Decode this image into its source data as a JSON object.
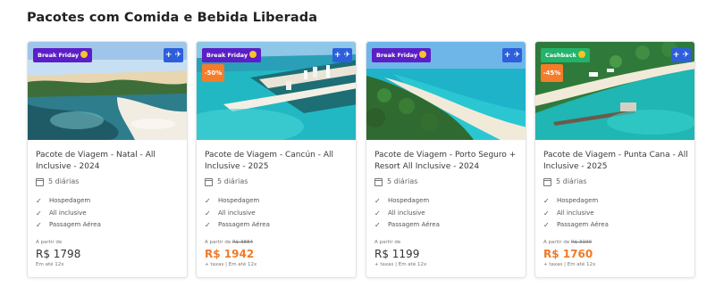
{
  "section_title": "Pacotes com Comida e Bebida Liberada",
  "cards": [
    {
      "badge": "Break Friday",
      "badge_color": "#5b1fc7",
      "type_icon": "flight-package-icon",
      "type_label": "+ ✈",
      "discount": "",
      "title": "Pacote de Viagem - Natal - All Inclusive - 2024",
      "duration": "5 diárias",
      "features": [
        "Hospedagem",
        "All inclusive",
        "Passagem Aérea"
      ],
      "from_label": "A partir de",
      "old_price": "",
      "price": "R$ 1798",
      "price_color": "#333333",
      "note": "Em até 12x"
    },
    {
      "badge": "Break Friday",
      "badge_color": "#5b1fc7",
      "type_icon": "flight-package-icon",
      "type_label": "+ ✈",
      "discount": "-50%",
      "title": "Pacote de Viagem - Cancún - All Inclusive - 2025",
      "duration": "5 diárias",
      "features": [
        "Hospedagem",
        "All inclusive",
        "Passagem Aérea"
      ],
      "from_label": "A partir de",
      "old_price": "R$ 3884",
      "price": "R$ 1942",
      "price_color": "#f07a2a",
      "note": "+ taxas | Em até 12x"
    },
    {
      "badge": "Break Friday",
      "badge_color": "#5b1fc7",
      "type_icon": "flight-package-icon",
      "type_label": "+ ✈",
      "discount": "",
      "title": "Pacote de Viagem - Porto Seguro + Resort All Inclusive - 2024",
      "duration": "5 diárias",
      "features": [
        "Hospedagem",
        "All inclusive",
        "Passagem Aérea"
      ],
      "from_label": "A partir de",
      "old_price": "",
      "price": "R$ 1199",
      "price_color": "#333333",
      "note": "+ taxas | Em até 12x"
    },
    {
      "badge": "Cashback",
      "badge_color": "#23b36a",
      "type_icon": "flight-package-icon",
      "type_label": "+ ✈",
      "discount": "-45%",
      "title": "Pacote de Viagem - Punta Cana - All Inclusive - 2025",
      "duration": "5 diárias",
      "features": [
        "Hospedagem",
        "All inclusive",
        "Passagem Aérea"
      ],
      "from_label": "A partir de",
      "old_price": "R$ 3190",
      "price": "R$ 1760",
      "price_color": "#f07a2a",
      "note": "+ taxas | Em até 12x"
    }
  ]
}
